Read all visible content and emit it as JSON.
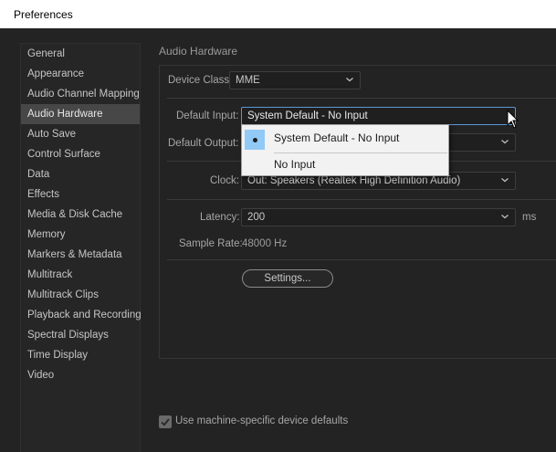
{
  "window": {
    "title": "Preferences"
  },
  "sidebar": {
    "items": [
      {
        "label": "General",
        "selected": false
      },
      {
        "label": "Appearance",
        "selected": false
      },
      {
        "label": "Audio Channel Mapping",
        "selected": false
      },
      {
        "label": "Audio Hardware",
        "selected": true
      },
      {
        "label": "Auto Save",
        "selected": false
      },
      {
        "label": "Control Surface",
        "selected": false
      },
      {
        "label": "Data",
        "selected": false
      },
      {
        "label": "Effects",
        "selected": false
      },
      {
        "label": "Media & Disk Cache",
        "selected": false
      },
      {
        "label": "Memory",
        "selected": false
      },
      {
        "label": "Markers & Metadata",
        "selected": false
      },
      {
        "label": "Multitrack",
        "selected": false
      },
      {
        "label": "Multitrack Clips",
        "selected": false
      },
      {
        "label": "Playback and Recording",
        "selected": false
      },
      {
        "label": "Spectral Displays",
        "selected": false
      },
      {
        "label": "Time Display",
        "selected": false
      },
      {
        "label": "Video",
        "selected": false
      }
    ]
  },
  "audio_hardware": {
    "section_title": "Audio Hardware",
    "device_class": {
      "label": "Device Class:",
      "value": "MME"
    },
    "default_input": {
      "label": "Default Input:",
      "value": "System Default - No Input"
    },
    "default_output": {
      "label": "Default Output:",
      "value": ""
    },
    "clock": {
      "label": "Clock:",
      "value": "Out: Speakers (Realtek High Definition Audio)"
    },
    "latency": {
      "label": "Latency:",
      "value": "200",
      "unit": "ms"
    },
    "sample_rate": {
      "label": "Sample Rate:",
      "value": "48000 Hz"
    },
    "settings_button": "Settings..."
  },
  "dropdown": {
    "options": [
      {
        "label": "System Default - No Input",
        "selected": true
      },
      {
        "label": "No Input",
        "selected": false
      }
    ]
  },
  "footer": {
    "machine_defaults": {
      "label": "Use machine-specific device defaults",
      "checked": true
    }
  },
  "colors": {
    "background": "#232323",
    "selected_item": "#474747",
    "focus_border": "#5a97d8",
    "dropdown_highlight": "#91c9f7"
  }
}
